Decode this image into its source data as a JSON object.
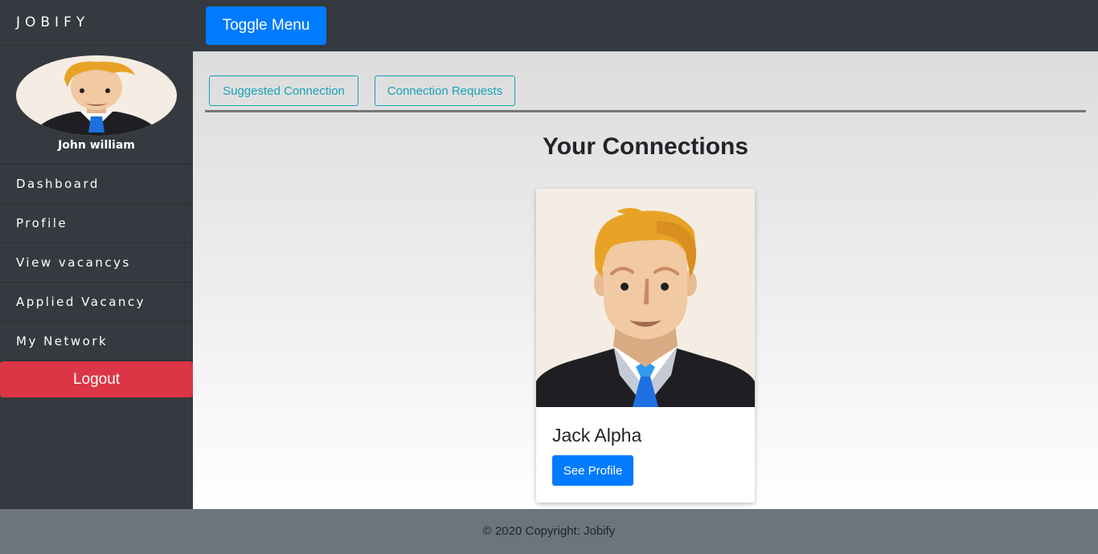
{
  "app": {
    "brand": "JOBIFY"
  },
  "sidebar": {
    "user_name": "John william",
    "items": [
      {
        "label": "Dashboard"
      },
      {
        "label": "Profile"
      },
      {
        "label": "View vacancys"
      },
      {
        "label": "Applied Vacancy"
      },
      {
        "label": "My Network"
      }
    ],
    "logout_label": "Logout"
  },
  "topbar": {
    "toggle_label": "Toggle Menu"
  },
  "main": {
    "tabs": [
      {
        "label": "Suggested Connection"
      },
      {
        "label": "Connection Requests"
      }
    ],
    "title": "Your Connections",
    "connections": [
      {
        "name": "Jack Alpha",
        "button_label": "See Profile"
      }
    ]
  },
  "footer": {
    "text": "© 2020 Copyright: Jobify"
  },
  "colors": {
    "sidebar_bg": "#343a40",
    "primary": "#007bff",
    "danger": "#dc3545",
    "info": "#17a2b8",
    "footer_bg": "#6c757d"
  }
}
